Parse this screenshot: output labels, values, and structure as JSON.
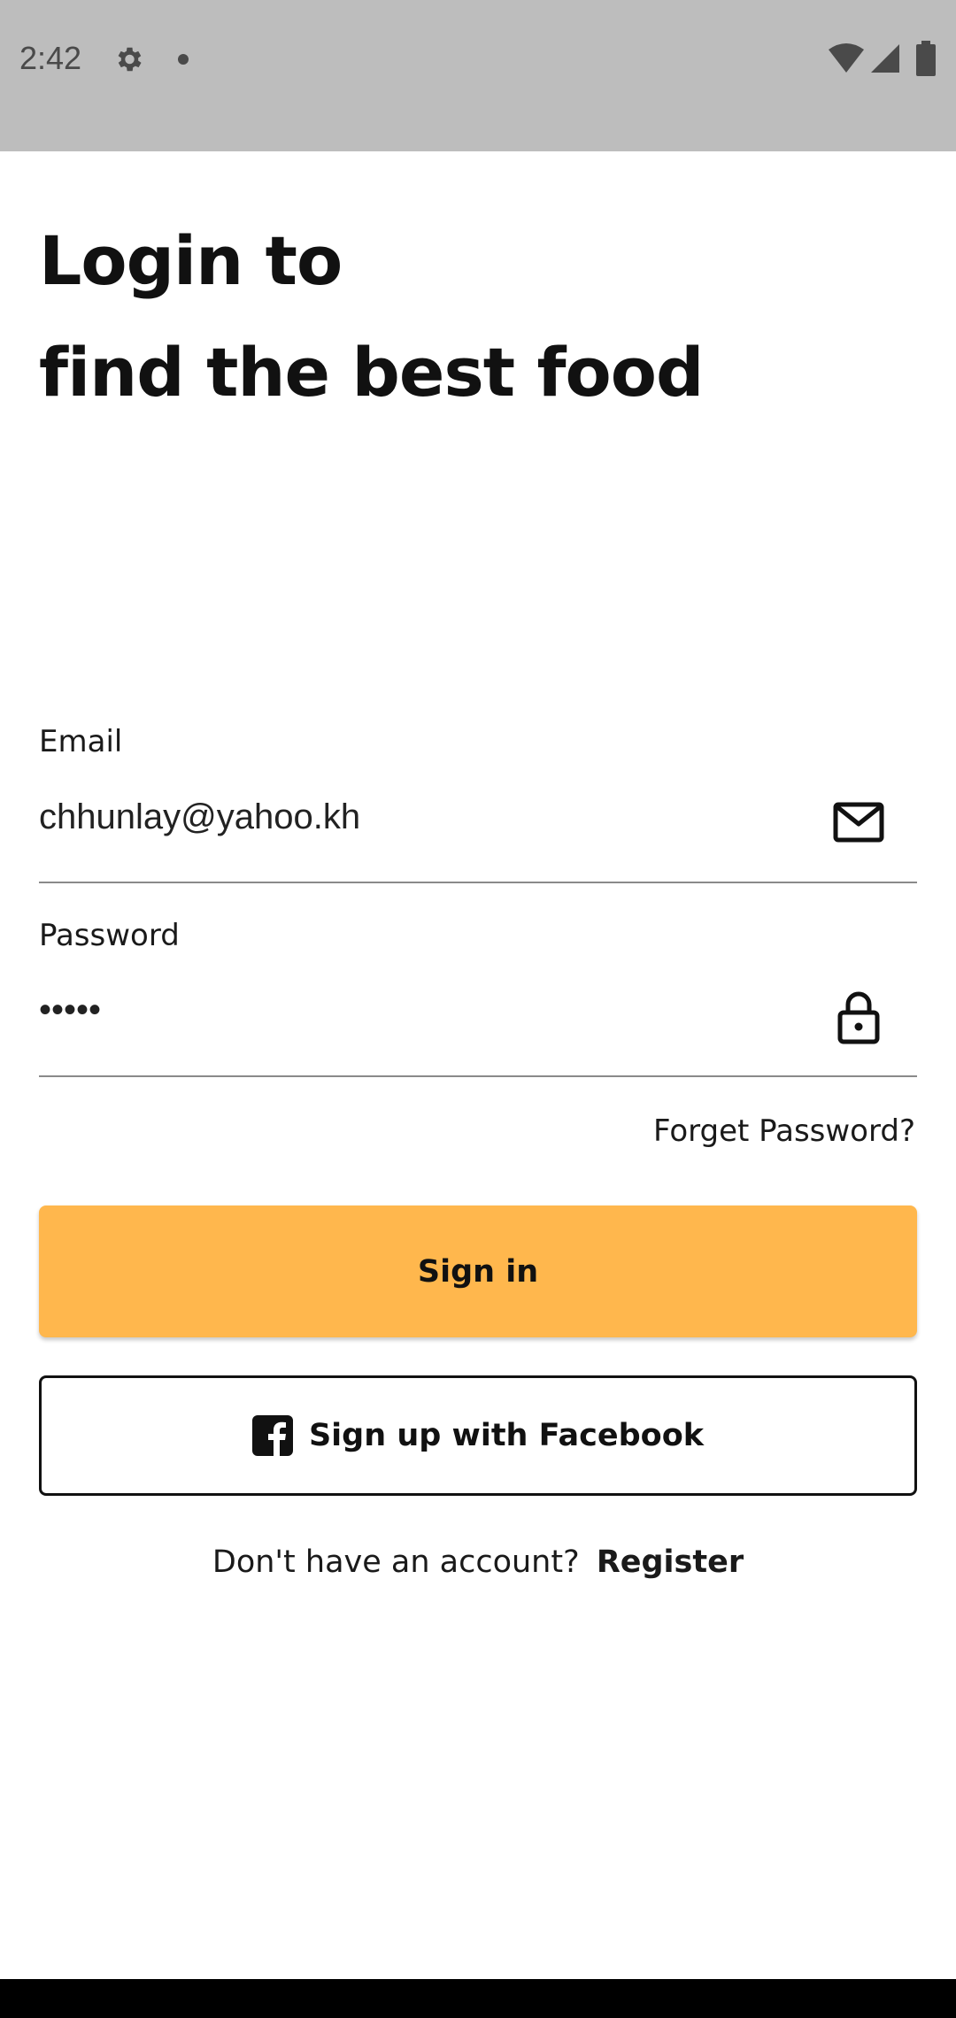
{
  "status_bar": {
    "time": "2:42",
    "icons": [
      "settings-icon",
      "notification-dot-icon",
      "wifi-icon",
      "signal-icon",
      "battery-icon"
    ]
  },
  "title": {
    "line1": "Login to",
    "line2": "find the best food"
  },
  "form": {
    "email": {
      "label": "Email",
      "value": "chhunlay@yahoo.kh",
      "icon": "mail-icon"
    },
    "password": {
      "label": "Password",
      "value": "•••••",
      "icon": "lock-icon"
    },
    "forget_password": "Forget Password?",
    "sign_in_label": "Sign in",
    "facebook_label": "Sign up with Facebook",
    "register_prompt": "Don't have an account?",
    "register_link": "Register"
  },
  "colors": {
    "status_bar": "#bdbdbd",
    "accent": "#ffb74d",
    "text": "#111111",
    "nav_bar": "#000000"
  }
}
